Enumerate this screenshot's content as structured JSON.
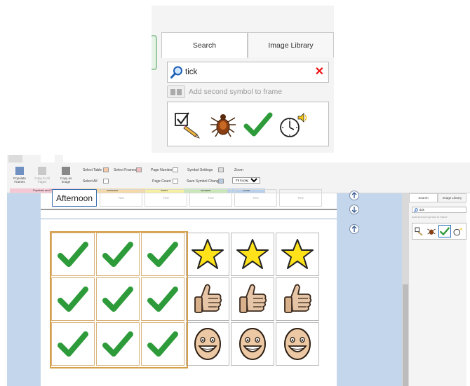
{
  "inset": {
    "tabs": [
      {
        "label": "Search",
        "active": true
      },
      {
        "label": "Image Library",
        "active": false
      }
    ],
    "search": {
      "value": "tick",
      "clear_icon": "close-x-icon"
    },
    "add_second_symbol": "Add second symbol to frame",
    "results": [
      "checkbox-pencil-icon",
      "tick-insect-icon",
      "green-checkmark-icon",
      "alarm-clock-icon"
    ]
  },
  "ribbon": {
    "buttons": {
      "populate": "Populate Frames",
      "copy_all": "Copy to All Pages",
      "copy_image": "Copy as Image",
      "select_table": "Select Table",
      "select_frames": "Select Frames",
      "select_all": "Select All",
      "page_number": "Page Number",
      "page_count": "Page Count",
      "symbol_settings": "Symbol Settings",
      "save_symbol_changes": "Save Symbol Changes",
      "zoom": "Zoom"
    },
    "zoom_value": "Fit to page",
    "groups": {
      "populate_copy": "Populate and Copy",
      "selection": "Selection",
      "insert": "Insert",
      "wordlist": "Wordlist",
      "zoom": "Zoom"
    }
  },
  "document": {
    "header_label": "Afternoon",
    "ghost_label": "Text",
    "grid": [
      [
        "check",
        "check",
        "check",
        "star",
        "star",
        "star"
      ],
      [
        "check",
        "check",
        "check",
        "thumbs-up",
        "thumbs-up",
        "thumbs-up"
      ],
      [
        "check",
        "check",
        "check",
        "smile",
        "smile",
        "smile"
      ]
    ]
  },
  "mini_panel": {
    "tabs": [
      "Search",
      "Image Library"
    ],
    "search_value": "tick",
    "add_second_symbol": "Add second symbol to frame"
  },
  "colors": {
    "accent_blue": "#3a6fb0",
    "check_green": "#2e9b3a",
    "star_yellow": "#ffe21a",
    "selection_orange": "#d6a04d",
    "canvas_blue": "#c4d6ec"
  }
}
